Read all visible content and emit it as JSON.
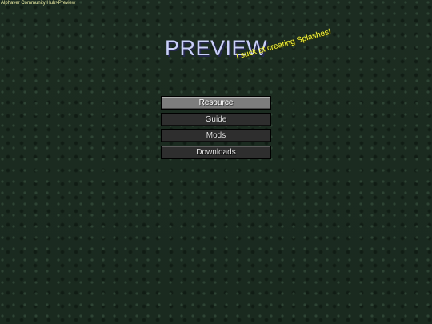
{
  "breadcrumb": "Alphaver Community Hub>Preview",
  "title": "PREVIEW",
  "splash": "I suck at creating Splashes!",
  "menu": {
    "items": [
      {
        "label": "Resource",
        "active": true
      },
      {
        "label": "Guide",
        "active": false
      },
      {
        "label": "Mods",
        "active": false
      },
      {
        "label": "Downloads",
        "active": false
      }
    ]
  },
  "colors": {
    "background": "#1b2b20",
    "title": "#c9cff8",
    "splash": "#ffff3a",
    "breadcrumb": "#f2f2a8",
    "button": "#2e2e2e",
    "button_active": "#7d7d7d"
  }
}
